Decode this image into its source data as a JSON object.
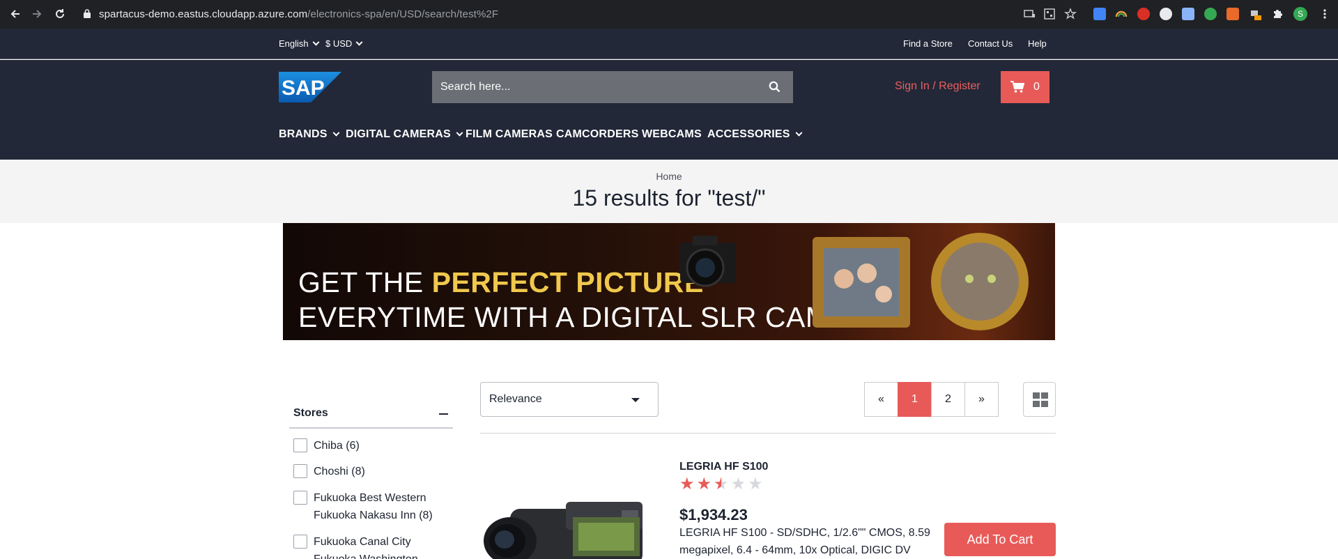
{
  "browser": {
    "url_host": "spartacus-demo.eastus.cloudapp.azure.com",
    "url_path": "/electronics-spa/en/USD/search/test%2F",
    "profile_initial": "S"
  },
  "utility": {
    "language": "English",
    "currency": "$ USD",
    "links": [
      "Find a Store",
      "Contact Us",
      "Help"
    ]
  },
  "header": {
    "logo_text": "SAP",
    "search_placeholder": "Search here...",
    "signin_label": "Sign In / Register",
    "cart_count": "0"
  },
  "nav": {
    "items": [
      "BRANDS",
      "DIGITAL CAMERAS",
      "FILM CAMERAS",
      "CAMCORDERS",
      "WEBCAMS",
      "ACCESSORIES"
    ]
  },
  "page": {
    "breadcrumb": "Home",
    "title": "15 results for \"test/\""
  },
  "banner": {
    "line1_prefix": "GET THE ",
    "line1_highlight": "PERFECT PICTURE",
    "line2": "EVERYTIME WITH A DIGITAL SLR CAMERA"
  },
  "facets": {
    "title": "Stores",
    "options": [
      "Chiba (6)",
      "Choshi (8)",
      "Fukuoka Best Western Fukuoka Nakasu Inn (8)",
      "Fukuoka Canal City Fukuoka Washington"
    ]
  },
  "sort": {
    "selected": "Relevance"
  },
  "pagination": {
    "prev": "«",
    "pages": [
      "1",
      "2"
    ],
    "next": "»",
    "current": "1"
  },
  "product": {
    "name": "LEGRIA HF S100",
    "rating": 2.5,
    "rating_max": 5,
    "price": "$1,934.23",
    "description": "LEGRIA HF S100 - SD/SDHC, 1/2.6\"\" CMOS, 8.59 megapixel, 6.4 - 64mm, 10x Optical, DIGIC DV",
    "add_to_cart": "Add To Cart"
  },
  "colors": {
    "header_bg": "#222838",
    "accent": "#e85a58",
    "signin": "#ec5f5f"
  }
}
